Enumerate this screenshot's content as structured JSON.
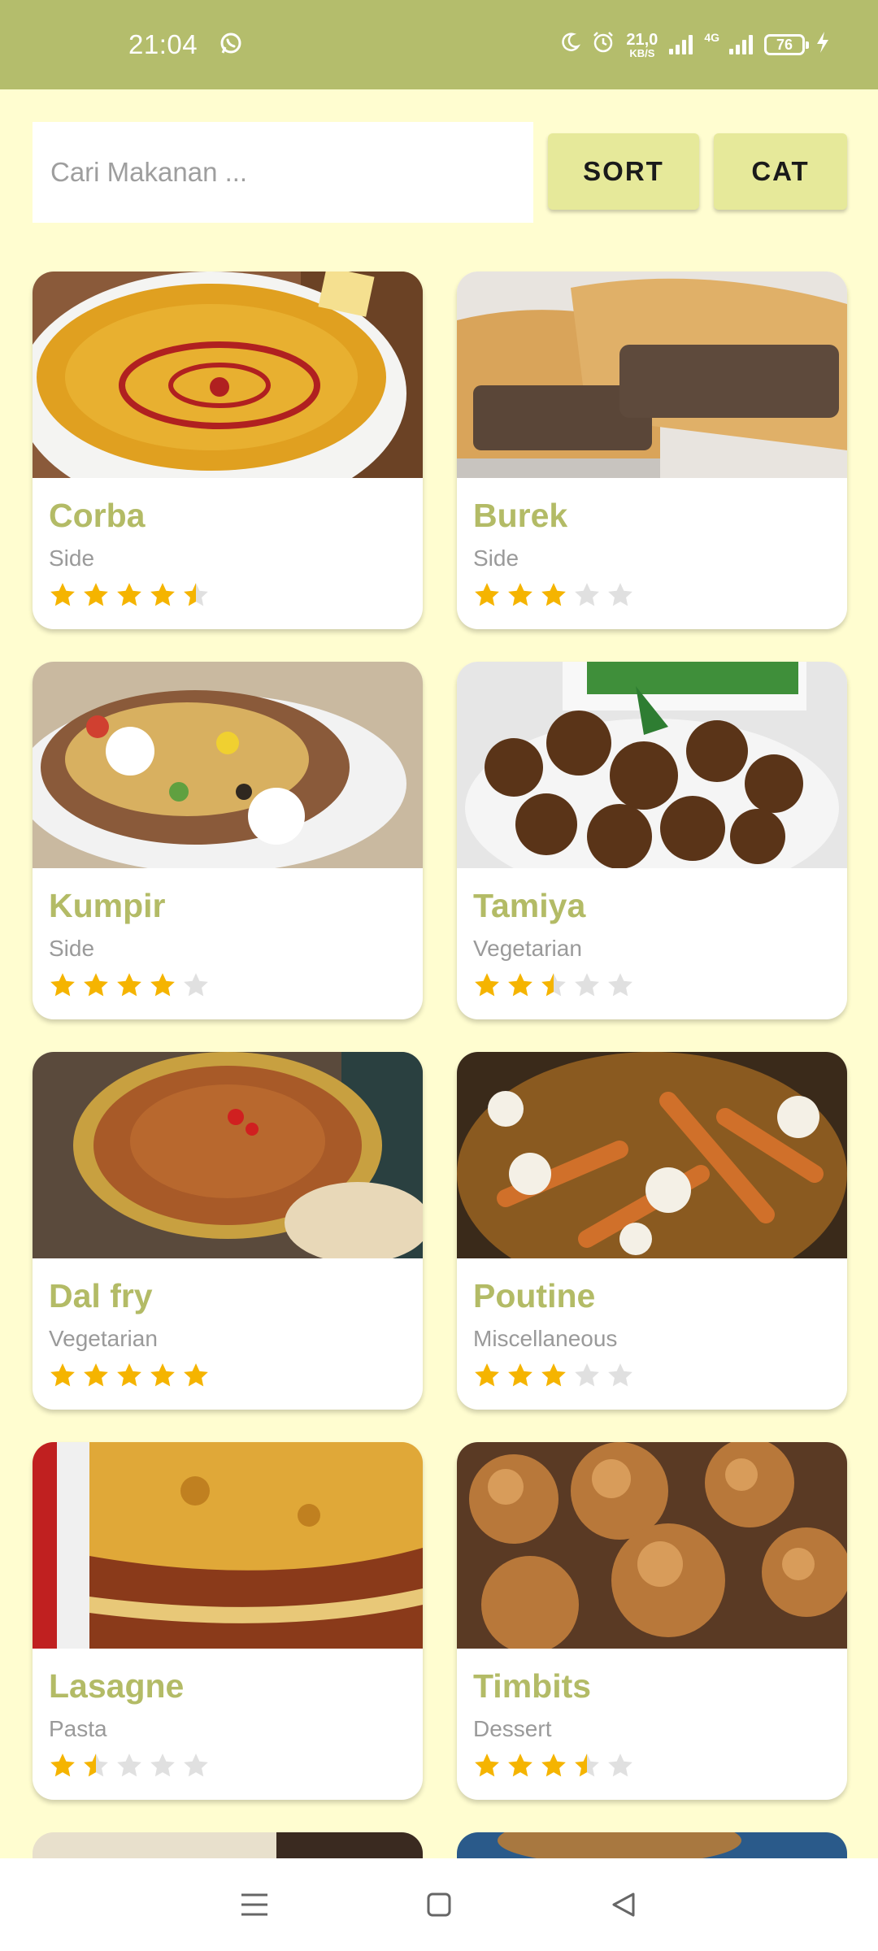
{
  "status_bar": {
    "time": "21:04",
    "net_speed_value": "21,0",
    "net_speed_unit": "KB/S",
    "network_type": "4G",
    "battery": "76"
  },
  "search": {
    "placeholder": "Cari Makanan ...",
    "value": ""
  },
  "buttons": {
    "sort": "SORT",
    "cat": "CAT"
  },
  "colors": {
    "accent": "#b3bb66",
    "status_bar": "#b4bd6c",
    "background": "#fffdd0",
    "button": "#e6e99a",
    "star": "#f5b400",
    "star_empty": "#e0e0e0"
  },
  "meals": [
    {
      "name": "Corba",
      "category": "Side",
      "rating": 4.5
    },
    {
      "name": "Burek",
      "category": "Side",
      "rating": 3
    },
    {
      "name": "Kumpir",
      "category": "Side",
      "rating": 4
    },
    {
      "name": "Tamiya",
      "category": "Vegetarian",
      "rating": 2.5
    },
    {
      "name": "Dal fry",
      "category": "Vegetarian",
      "rating": 5
    },
    {
      "name": "Poutine",
      "category": "Miscellaneous",
      "rating": 3
    },
    {
      "name": "Lasagne",
      "category": "Pasta",
      "rating": 1.5
    },
    {
      "name": "Timbits",
      "category": "Dessert",
      "rating": 3.5
    }
  ],
  "nav": {
    "icons": [
      "menu-icon",
      "home-square-icon",
      "back-triangle-icon"
    ]
  }
}
